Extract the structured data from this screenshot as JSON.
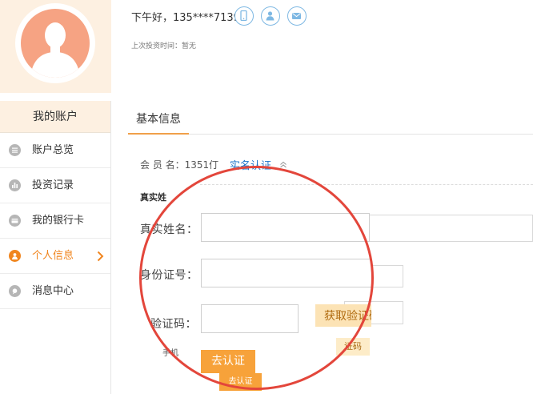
{
  "header": {
    "greeting": "下午好，135****7139",
    "last_invest": "上次投资时间：暂无",
    "icons": [
      "phone-icon",
      "user-icon",
      "mail-icon"
    ]
  },
  "sidebar": {
    "title": "我的账户",
    "items": [
      {
        "label": "账户总览",
        "icon": "list-icon",
        "active": false
      },
      {
        "label": "投资记录",
        "icon": "chart-icon",
        "active": false
      },
      {
        "label": "我的银行卡",
        "icon": "card-icon",
        "active": false
      },
      {
        "label": "个人信息",
        "icon": "person-icon",
        "active": true
      },
      {
        "label": "消息中心",
        "icon": "message-icon",
        "active": false
      }
    ]
  },
  "main": {
    "tab": "基本信息",
    "member_label": "会 员 名：",
    "member_value": "1351仃",
    "realname_link": "实名认证",
    "section_title": "真实姓",
    "form": {
      "name_label": "真实姓名：",
      "id_label": "身份证号：",
      "code_label": "验证码：",
      "get_code": "获取验证码",
      "submit": "去认证"
    },
    "background_form": {
      "phone_label": "手机",
      "get_code": "证码",
      "submit": "去认证"
    }
  },
  "colors": {
    "accent": "#f0851e",
    "link": "#1a73c9",
    "header_bg": "#fdf0e1",
    "circle": "#e3463b",
    "avatar": "#f6a383"
  }
}
